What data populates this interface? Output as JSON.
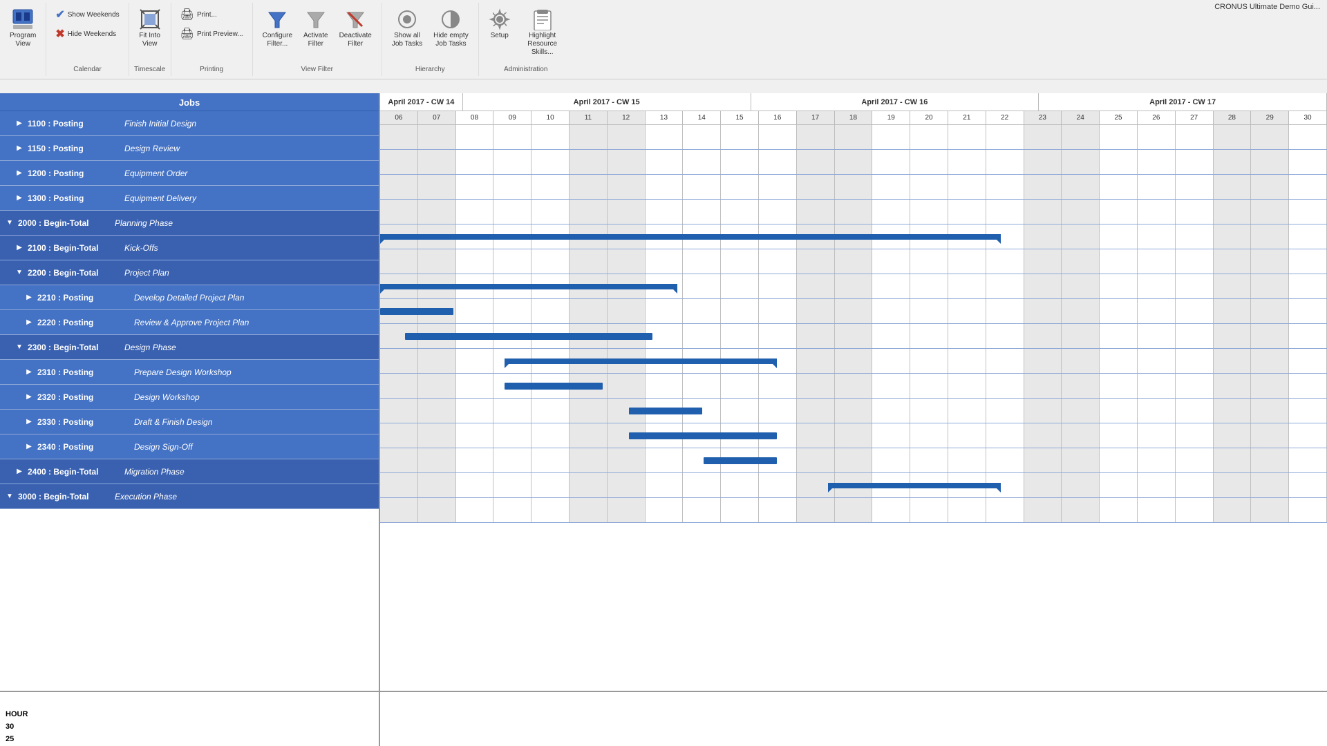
{
  "app": {
    "title": "CRONUS Ultimate Demo Gui..."
  },
  "toolbar": {
    "groups": [
      {
        "label": "",
        "buttons": [
          {
            "id": "program-view",
            "icon": "📊",
            "label": "Program\nView",
            "large": true
          }
        ]
      },
      {
        "label": "Calendar",
        "buttons": [
          {
            "id": "show-weekends",
            "icon": "✔",
            "label": "Show\nWeekends",
            "large": false
          },
          {
            "id": "hide-weekends",
            "icon": "✖",
            "label": "Hide\nWeekends",
            "large": false
          }
        ]
      },
      {
        "label": "Timescale",
        "buttons": [
          {
            "id": "fit-into-view",
            "icon": "⊞",
            "label": "Fit Into\nView",
            "large": true
          }
        ]
      },
      {
        "label": "Printing",
        "buttons": [
          {
            "id": "print",
            "icon": "🖨",
            "label": "Print...",
            "large": false
          },
          {
            "id": "print-preview",
            "icon": "🖨",
            "label": "Print\nPreview...",
            "large": false
          }
        ]
      },
      {
        "label": "View Filter",
        "buttons": [
          {
            "id": "configure-filter",
            "icon": "▽",
            "label": "Configure\nFilter...",
            "large": false
          },
          {
            "id": "activate-filter",
            "icon": "▽",
            "label": "Activate\nFilter",
            "large": false
          },
          {
            "id": "deactivate-filter",
            "icon": "▽",
            "label": "Deactivate\nFilter",
            "large": false
          }
        ]
      },
      {
        "label": "Hierarchy",
        "buttons": [
          {
            "id": "show-all-job-tasks",
            "icon": "○",
            "label": "Show all\nJob Tasks",
            "large": false
          },
          {
            "id": "hide-empty-job-tasks",
            "icon": "◑",
            "label": "Hide empty\nJob Tasks",
            "large": false
          }
        ]
      },
      {
        "label": "Administration",
        "buttons": [
          {
            "id": "setup",
            "icon": "⚙",
            "label": "Setup",
            "large": false
          },
          {
            "id": "highlight-resource",
            "icon": "📋",
            "label": "Highlight\nResource Skills...",
            "large": false
          }
        ]
      }
    ]
  },
  "jobs_panel": {
    "header": "Jobs",
    "rows": [
      {
        "id": "1100",
        "type": "Posting",
        "name": "Finish Initial Design",
        "level": 1,
        "expand": "▶",
        "expanded": false
      },
      {
        "id": "1150",
        "type": "Posting",
        "name": "Design Review",
        "level": 1,
        "expand": "▶",
        "expanded": false
      },
      {
        "id": "1200",
        "type": "Posting",
        "name": "Equipment Order",
        "level": 1,
        "expand": "▶",
        "expanded": false
      },
      {
        "id": "1300",
        "type": "Posting",
        "name": "Equipment Delivery",
        "level": 1,
        "expand": "▶",
        "expanded": false
      },
      {
        "id": "2000",
        "type": "Begin-Total",
        "name": "Planning Phase",
        "level": 0,
        "expand": "▼",
        "expanded": true
      },
      {
        "id": "2100",
        "type": "Begin-Total",
        "name": "Kick-Offs",
        "level": 1,
        "expand": "▶",
        "expanded": false
      },
      {
        "id": "2200",
        "type": "Begin-Total",
        "name": "Project Plan",
        "level": 1,
        "expand": "▼",
        "expanded": true
      },
      {
        "id": "2210",
        "type": "Posting",
        "name": "Develop Detailed Project Plan",
        "level": 2,
        "expand": "▶",
        "expanded": false
      },
      {
        "id": "2220",
        "type": "Posting",
        "name": "Review & Approve Project Plan",
        "level": 2,
        "expand": "▶",
        "expanded": false
      },
      {
        "id": "2300",
        "type": "Begin-Total",
        "name": "Design Phase",
        "level": 1,
        "expand": "▼",
        "expanded": true
      },
      {
        "id": "2310",
        "type": "Posting",
        "name": "Prepare Design Workshop",
        "level": 2,
        "expand": "▶",
        "expanded": false
      },
      {
        "id": "2320",
        "type": "Posting",
        "name": "Design Workshop",
        "level": 2,
        "expand": "▶",
        "expanded": false
      },
      {
        "id": "2330",
        "type": "Posting",
        "name": "Draft & Finish Design",
        "level": 2,
        "expand": "▶",
        "expanded": false
      },
      {
        "id": "2340",
        "type": "Posting",
        "name": "Design Sign-Off",
        "level": 2,
        "expand": "▶",
        "expanded": false
      },
      {
        "id": "2400",
        "type": "Begin-Total",
        "name": "Migration Phase",
        "level": 1,
        "expand": "▶",
        "expanded": false
      },
      {
        "id": "3000",
        "type": "Begin-Total",
        "name": "Execution Phase",
        "level": 0,
        "expand": "▼",
        "expanded": true
      }
    ]
  },
  "gantt": {
    "weeks": [
      {
        "label": "April 2017 - CW 14",
        "days": 2
      },
      {
        "label": "April 2017 - CW 15",
        "days": 7
      },
      {
        "label": "April 2017 - CW 16",
        "days": 7
      },
      {
        "label": "April 2017 - CW 17",
        "days": 7
      }
    ],
    "days": [
      "06",
      "07",
      "08",
      "09",
      "10",
      "11",
      "12",
      "13",
      "14",
      "15",
      "16",
      "17",
      "18",
      "19",
      "20",
      "21",
      "22",
      "23",
      "24",
      "25",
      "26",
      "27",
      "28",
      "29",
      "30"
    ],
    "weekends": [
      0,
      1,
      5,
      6,
      11,
      12,
      17,
      18,
      22,
      23
    ],
    "bars": [
      {
        "row": 4,
        "start": 0,
        "width": 25,
        "type": "summary"
      },
      {
        "row": 6,
        "start": 0,
        "width": 12,
        "type": "summary"
      },
      {
        "row": 7,
        "start": 0,
        "width": 3,
        "type": "normal"
      },
      {
        "row": 8,
        "start": 1,
        "width": 10,
        "type": "normal"
      },
      {
        "row": 9,
        "start": 5,
        "width": 11,
        "type": "summary"
      },
      {
        "row": 10,
        "start": 5,
        "width": 4,
        "type": "normal"
      },
      {
        "row": 11,
        "start": 10,
        "width": 3,
        "type": "normal"
      },
      {
        "row": 12,
        "start": 10,
        "width": 6,
        "type": "normal"
      },
      {
        "row": 13,
        "start": 13,
        "width": 3,
        "type": "normal"
      },
      {
        "row": 14,
        "start": 18,
        "width": 7,
        "type": "summary"
      }
    ]
  },
  "bottom_chart": {
    "label_lines": [
      "HOUR",
      "30",
      "25"
    ]
  }
}
